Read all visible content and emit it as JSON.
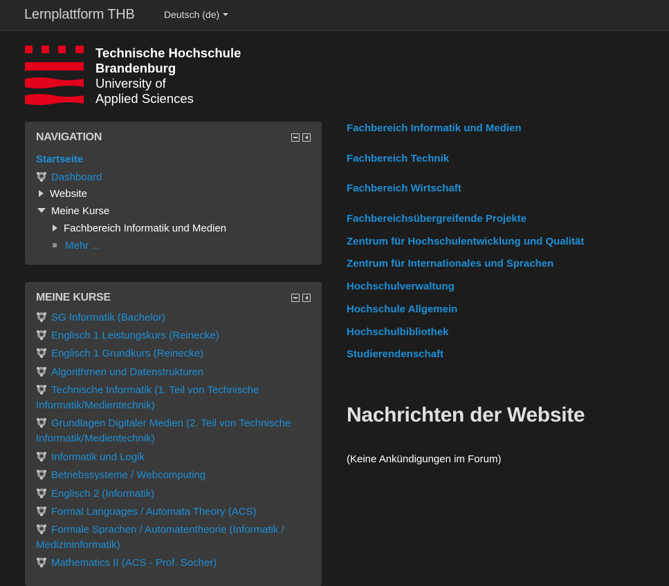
{
  "navbar": {
    "brand": "Lernplattform THB",
    "language": "Deutsch (de)"
  },
  "logo": {
    "line1": "Technische Hochschule",
    "line2": "Brandenburg",
    "line3": "University of",
    "line4": "Applied Sciences",
    "colors": {
      "red": "#e2001a",
      "text": "#ffffff"
    }
  },
  "navigation": {
    "title": "NAVIGATION",
    "home": "Startseite",
    "dashboard": "Dashboard",
    "website": "Website",
    "my_courses": "Meine Kurse",
    "faculty_cs": "Fachbereich Informatik und Medien",
    "more": "Mehr ..."
  },
  "my_courses": {
    "title": "MEINE KURSE",
    "items": [
      "SG Informatik (Bachelor)",
      "Englisch 1 Leistungskurs (Reinecke)",
      "Englisch 1 Grundkurs (Reinecke)",
      "Algorithmen und Datenstrukturen",
      "Technische Informatik (1. Teil von Technische Informatik/Medientechnik)",
      "Grundlagen Digitaler Medien (2. Teil von Technische Informatik/Medientechnik)",
      "Informatik und Logik",
      "Betriebssysteme / Webcomputing",
      "Englisch 2 (Informatik)",
      "Formal Languages / Automata Theory (ACS)",
      "Formale Sprachen / Automatentheorie (Informatik / Medizininformatik)",
      "Mathematics II (ACS - Prof. Socher)"
    ]
  },
  "categories": [
    "Fachbereich Informatik und Medien",
    "Fachbereich Technik",
    "Fachbereich Wirtschaft",
    "Fachbereichsübergreifende Projekte",
    "Zentrum für Hochschulentwicklung und Qualität",
    "Zentrum für Internationales und Sprachen",
    "Hochschulverwaltung",
    "Hochschule Allgemein",
    "Hochschulbibliothek",
    "Studierendenschaft"
  ],
  "news": {
    "title": "Nachrichten der Website",
    "empty": "(Keine Ankündigungen im Forum)"
  },
  "colors": {
    "background": "#1c1c1c",
    "navbar": "#272727",
    "block": "#3a3a3a",
    "link": "#1e8fd6"
  },
  "icons": {
    "course": "course-icon",
    "block_minimize": "minimize-icon",
    "block_dock": "dock-icon"
  }
}
